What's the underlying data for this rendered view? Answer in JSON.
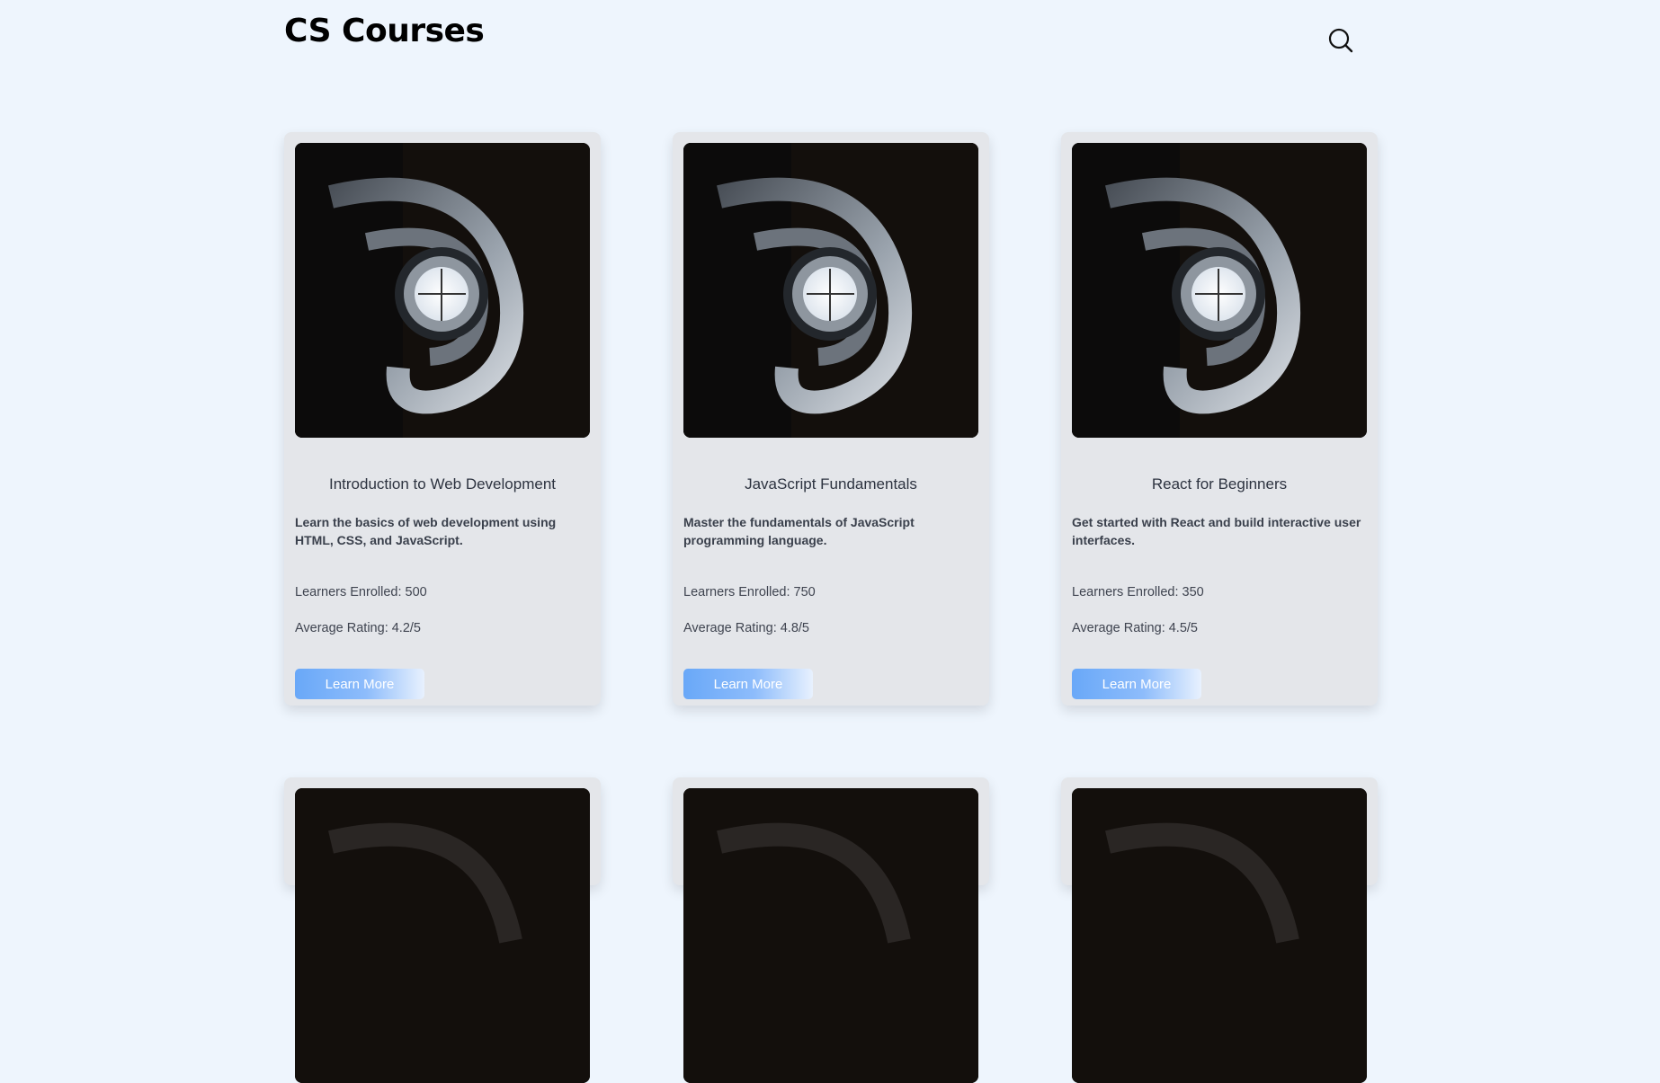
{
  "header": {
    "title": "CS Courses",
    "search_icon": "search-icon"
  },
  "colors": {
    "page_background": "#eef5fd",
    "card_background": "#e4e6ea",
    "button_gradient_start": "#69a8f8",
    "button_gradient_end": "#e8f1fe"
  },
  "courses": [
    {
      "title": "Introduction to Web Development",
      "description": "Learn the basics of web development using HTML, CSS, and JavaScript.",
      "learners": "Learners Enrolled: 500",
      "rating": "Average Rating: 4.2/5",
      "button_label": "Learn More",
      "image": "spiral-staircase-photo"
    },
    {
      "title": "JavaScript Fundamentals",
      "description": "Master the fundamentals of JavaScript programming language.",
      "learners": "Learners Enrolled: 750",
      "rating": "Average Rating: 4.8/5",
      "button_label": "Learn More",
      "image": "spiral-staircase-photo"
    },
    {
      "title": "React for Beginners",
      "description": "Get started with React and build interactive user interfaces.",
      "learners": "Learners Enrolled: 350",
      "rating": "Average Rating: 4.5/5",
      "button_label": "Learn More",
      "image": "spiral-staircase-photo"
    },
    {
      "image": "spiral-staircase-photo"
    },
    {
      "image": "spiral-staircase-photo"
    },
    {
      "image": "spiral-staircase-photo"
    }
  ]
}
